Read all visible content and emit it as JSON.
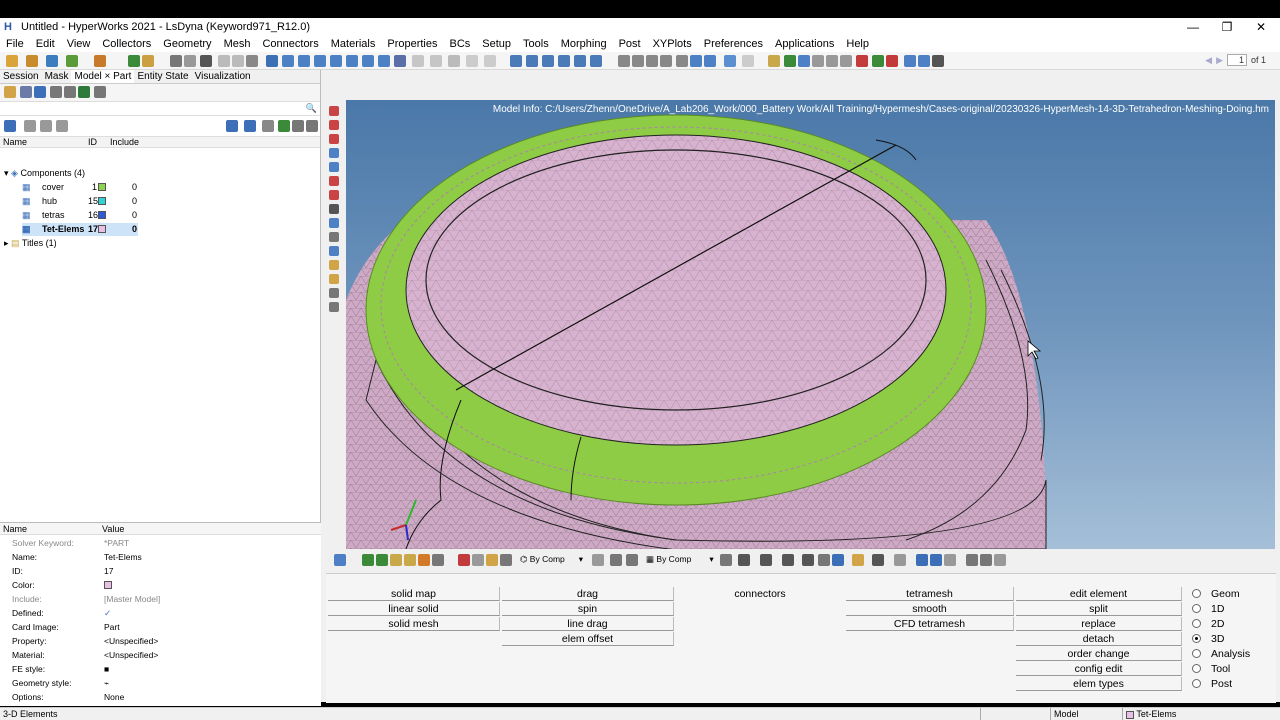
{
  "window": {
    "title": "Untitled - HyperWorks 2021 - LsDyna (Keyword971_R12.0)",
    "minimize": "—",
    "maximize": "❐",
    "close": "✕"
  },
  "menu": [
    "File",
    "Edit",
    "View",
    "Collectors",
    "Geometry",
    "Mesh",
    "Connectors",
    "Materials",
    "Properties",
    "BCs",
    "Setup",
    "Tools",
    "Morphing",
    "Post",
    "XYPlots",
    "Preferences",
    "Applications",
    "Help"
  ],
  "pager": {
    "value": "1",
    "label": "of 1"
  },
  "left_tabs": [
    "Session",
    "Mask",
    "Model × Part",
    "Entity State",
    "Visualization"
  ],
  "tree": {
    "header": {
      "name": "Name",
      "id": "ID",
      "include": "Include"
    },
    "components_label": "Components (4)",
    "items": [
      {
        "name": "cover",
        "id": "1",
        "color": "#8fd14f",
        "include": "0"
      },
      {
        "name": "hub",
        "id": "15",
        "color": "#2fd3d3",
        "include": "0"
      },
      {
        "name": "tetras",
        "id": "16",
        "color": "#2d5bd6",
        "include": "0"
      },
      {
        "name": "Tet-Elems",
        "id": "17",
        "color": "#e8c0e6",
        "include": "0"
      }
    ],
    "titles_label": "Titles (1)"
  },
  "properties": {
    "header": {
      "name": "Name",
      "value": "Value"
    },
    "rows": [
      {
        "key": "Solver Keyword:",
        "value": "*PART"
      },
      {
        "key": "Name:",
        "value": "Tet-Elems"
      },
      {
        "key": "ID:",
        "value": "17"
      },
      {
        "key": "Color:",
        "value": ""
      },
      {
        "key": "Include:",
        "value": "[Master Model]"
      },
      {
        "key": "Defined:",
        "value": "✓"
      },
      {
        "key": "Card Image:",
        "value": "Part"
      },
      {
        "key": "Property:",
        "value": "<Unspecified>"
      },
      {
        "key": "Material:",
        "value": "<Unspecified>"
      },
      {
        "key": "FE style:",
        "value": "■"
      },
      {
        "key": "Geometry style:",
        "value": "⌁"
      },
      {
        "key": "Options:",
        "value": "None"
      }
    ]
  },
  "viewport": {
    "model_info": "Model Info: C:/Users/Zhenn/OneDrive/A_Lab206_Work/000_Battery Work/All Training/Hypermesh/Cases-original/20230326-HyperMesh-14-3D-Tetrahedron-Meshing-Doing.hm"
  },
  "bottom_toolbar": {
    "by_comp_1": "By Comp",
    "by_comp_2": "By Comp"
  },
  "panels": {
    "col1": [
      "solid map",
      "linear solid",
      "solid mesh"
    ],
    "col2": [
      "drag",
      "spin",
      "line drag",
      "elem offset"
    ],
    "col3": [
      "connectors"
    ],
    "col4": [
      "tetramesh",
      "smooth",
      "CFD tetramesh"
    ],
    "col5": [
      "edit element",
      "split",
      "replace",
      "detach",
      "order change",
      "config edit",
      "elem types"
    ],
    "radios": [
      {
        "label": "Geom",
        "on": false
      },
      {
        "label": "1D",
        "on": false
      },
      {
        "label": "2D",
        "on": false
      },
      {
        "label": "3D",
        "on": true
      },
      {
        "label": "Analysis",
        "on": false
      },
      {
        "label": "Tool",
        "on": false
      },
      {
        "label": "Post",
        "on": false
      }
    ]
  },
  "status": {
    "left": "3-D Elements",
    "model": "Model",
    "comp": "Tet-Elems"
  }
}
